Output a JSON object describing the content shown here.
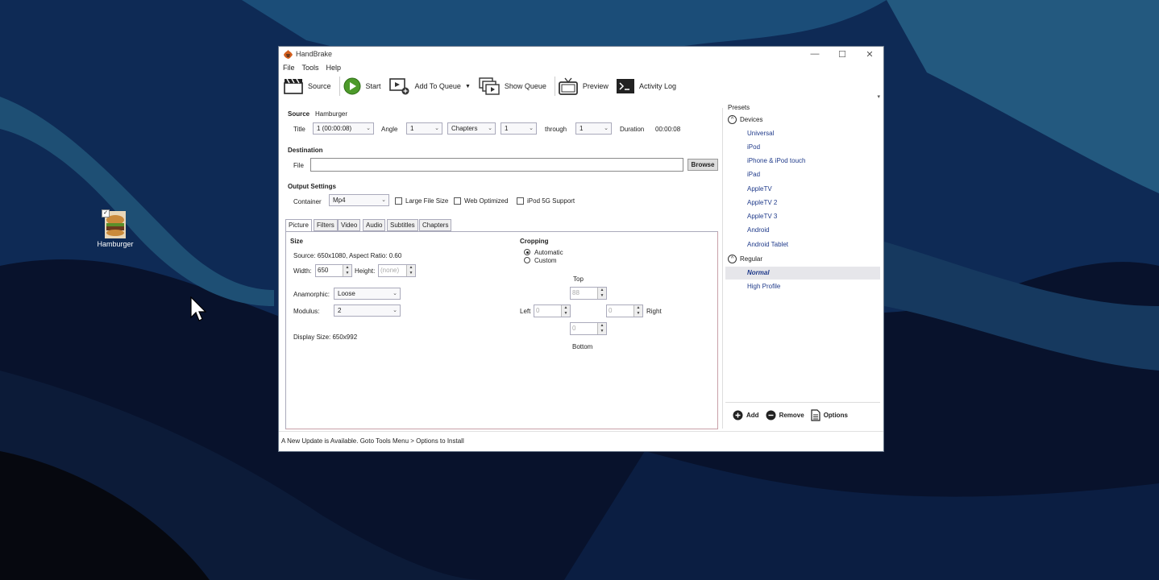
{
  "desktop": {
    "icon_label": "Hamburger"
  },
  "window": {
    "title": "HandBrake",
    "controls": {
      "minimize": "—",
      "maximize": "☐",
      "close": "✕"
    }
  },
  "menu": {
    "items": [
      "File",
      "Tools",
      "Help"
    ]
  },
  "toolbar": {
    "source": "Source",
    "start": "Start",
    "add_to_queue": "Add To Queue",
    "show_queue": "Show Queue",
    "preview": "Preview",
    "activity_log": "Activity Log"
  },
  "source": {
    "label": "Source",
    "value": "Hamburger",
    "title_label": "Title",
    "title_value": "1 (00:00:08)",
    "angle_label": "Angle",
    "angle_value": "1",
    "range_type": "Chapters",
    "range_from": "1",
    "through_label": "through",
    "range_to": "1",
    "duration_label": "Duration",
    "duration_value": "00:00:08"
  },
  "destination": {
    "label": "Destination",
    "file_label": "File",
    "file_value": "",
    "browse": "Browse"
  },
  "output": {
    "label": "Output Settings",
    "container_label": "Container",
    "container_value": "Mp4",
    "large_file": "Large File Size",
    "web_optimized": "Web Optimized",
    "ipod_5g": "iPod 5G Support"
  },
  "tabs": [
    "Picture",
    "Filters",
    "Video",
    "Audio",
    "Subtitles",
    "Chapters"
  ],
  "picture": {
    "size_heading": "Size",
    "source_info": "Source:  650x1080, Aspect Ratio: 0.60",
    "width_label": "Width:",
    "width_value": "650",
    "height_label": "Height:",
    "height_placeholder": "(none)",
    "anamorphic_label": "Anamorphic:",
    "anamorphic_value": "Loose",
    "modulus_label": "Modulus:",
    "modulus_value": "2",
    "display_size": "Display Size:  650x992",
    "cropping_heading": "Cropping",
    "automatic": "Automatic",
    "custom": "Custom",
    "top_label": "Top",
    "top_value": "88",
    "left_label": "Left",
    "left_value": "0",
    "right_value": "0",
    "right_label": "Right",
    "bottom_value": "0",
    "bottom_label": "Bottom"
  },
  "presets": {
    "label": "Presets",
    "devices_label": "Devices",
    "devices": [
      "Universal",
      "iPod",
      "iPhone & iPod touch",
      "iPad",
      "AppleTV",
      "AppleTV 2",
      "AppleTV 3",
      "Android",
      "Android Tablet"
    ],
    "regular_label": "Regular",
    "regular": [
      "Normal",
      "High Profile"
    ],
    "add": "Add",
    "remove": "Remove",
    "options": "Options"
  },
  "status": "A New Update is Available. Goto Tools Menu > Options to Install"
}
